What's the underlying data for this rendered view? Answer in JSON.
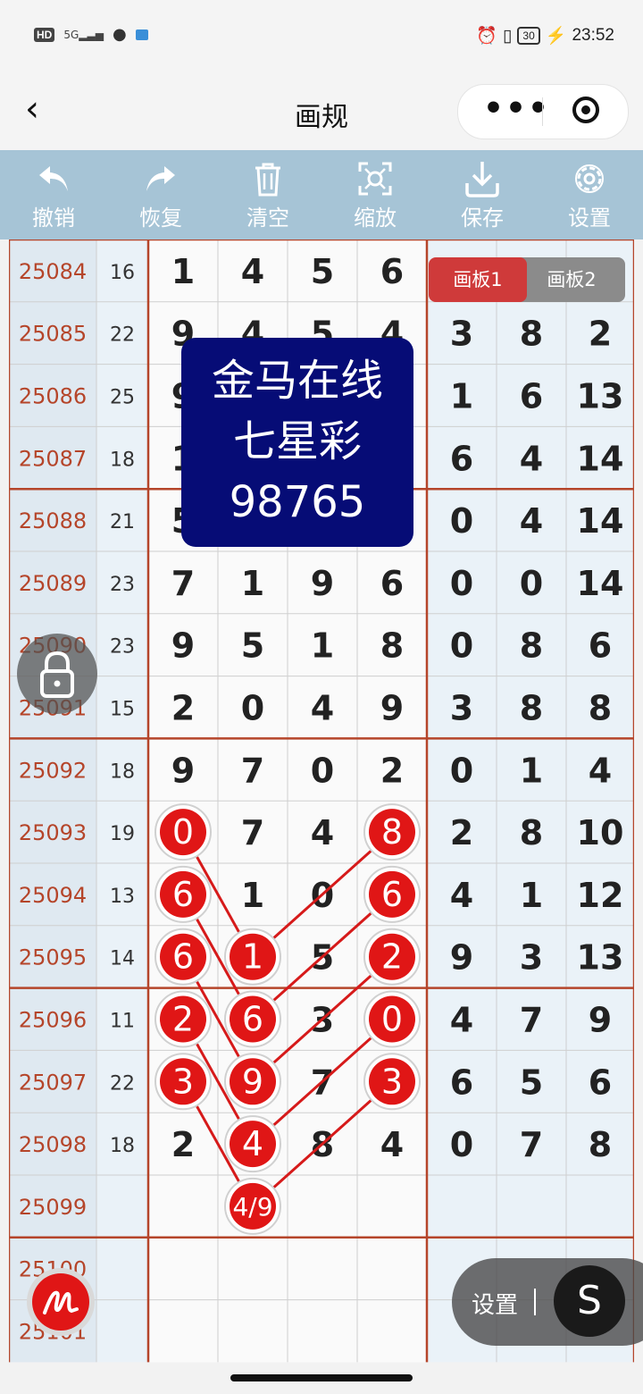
{
  "status_bar": {
    "hd": "HD",
    "signal": "5G",
    "battery": "30",
    "time": "23:52"
  },
  "nav": {
    "title": "画规"
  },
  "toolbar": [
    {
      "label": "撤销",
      "icon": "undo-icon"
    },
    {
      "label": "恢复",
      "icon": "redo-icon"
    },
    {
      "label": "清空",
      "icon": "trash-icon"
    },
    {
      "label": "缩放",
      "icon": "zoom-icon"
    },
    {
      "label": "保存",
      "icon": "save-icon"
    },
    {
      "label": "设置",
      "icon": "gear-icon"
    }
  ],
  "board_tabs": {
    "tab1": "画板1",
    "tab2": "画板2"
  },
  "watermark": {
    "line1": "金马在线",
    "line2": "七星彩",
    "line3": "98765"
  },
  "colors": {
    "accent_red": "#e01616",
    "toolbar": "#a6c4d6",
    "period_text": "#b5452a",
    "watermark_bg": "#060c76"
  },
  "table": {
    "rows": [
      {
        "period": "25084",
        "sum": "16",
        "front": [
          "1",
          "4",
          "5",
          "6"
        ],
        "back": [
          "",
          "",
          ""
        ]
      },
      {
        "period": "25085",
        "sum": "22",
        "front": [
          "9",
          "4",
          "5",
          "4"
        ],
        "back": [
          "3",
          "8",
          "2"
        ]
      },
      {
        "period": "25086",
        "sum": "25",
        "front": [
          "9",
          "",
          "",
          ""
        ],
        "back": [
          "1",
          "6",
          "13"
        ]
      },
      {
        "period": "25087",
        "sum": "18",
        "front": [
          "1",
          "",
          "",
          ""
        ],
        "back": [
          "6",
          "4",
          "14"
        ]
      },
      {
        "period": "25088",
        "sum": "21",
        "front": [
          "5",
          "",
          "",
          ""
        ],
        "back": [
          "0",
          "4",
          "14"
        ]
      },
      {
        "period": "25089",
        "sum": "23",
        "front": [
          "7",
          "1",
          "9",
          "6"
        ],
        "back": [
          "0",
          "0",
          "14"
        ]
      },
      {
        "period": "25090",
        "sum": "23",
        "front": [
          "9",
          "5",
          "1",
          "8"
        ],
        "back": [
          "0",
          "8",
          "6"
        ]
      },
      {
        "period": "25091",
        "sum": "15",
        "front": [
          "2",
          "0",
          "4",
          "9"
        ],
        "back": [
          "3",
          "8",
          "8"
        ]
      },
      {
        "period": "25092",
        "sum": "18",
        "front": [
          "9",
          "7",
          "0",
          "2"
        ],
        "back": [
          "0",
          "1",
          "4"
        ]
      },
      {
        "period": "25093",
        "sum": "19",
        "front": [
          "0",
          "7",
          "4",
          "8"
        ],
        "back": [
          "2",
          "8",
          "10"
        ]
      },
      {
        "period": "25094",
        "sum": "13",
        "front": [
          "6",
          "1",
          "0",
          "6"
        ],
        "back": [
          "4",
          "1",
          "12"
        ]
      },
      {
        "period": "25095",
        "sum": "14",
        "front": [
          "6",
          "1",
          "5",
          "2"
        ],
        "back": [
          "9",
          "3",
          "13"
        ]
      },
      {
        "period": "25096",
        "sum": "11",
        "front": [
          "2",
          "6",
          "3",
          "0"
        ],
        "back": [
          "4",
          "7",
          "9"
        ]
      },
      {
        "period": "25097",
        "sum": "22",
        "front": [
          "3",
          "9",
          "7",
          "3"
        ],
        "back": [
          "6",
          "5",
          "6"
        ]
      },
      {
        "period": "25098",
        "sum": "18",
        "front": [
          "2",
          "4",
          "8",
          "4"
        ],
        "back": [
          "0",
          "7",
          "8"
        ]
      },
      {
        "period": "25099",
        "sum": "",
        "front": [
          "",
          "4/9",
          "",
          ""
        ],
        "back": [
          "",
          "",
          ""
        ]
      },
      {
        "period": "25100",
        "sum": "",
        "front": [
          "",
          "",
          "",
          ""
        ],
        "back": [
          "",
          "",
          ""
        ]
      },
      {
        "period": "25101",
        "sum": "",
        "front": [
          "",
          "",
          "",
          ""
        ],
        "back": [
          "",
          "",
          ""
        ]
      }
    ],
    "marks": [
      {
        "row": 9,
        "col": 0,
        "text": "0"
      },
      {
        "row": 10,
        "col": 0,
        "text": "6"
      },
      {
        "row": 11,
        "col": 0,
        "text": "6"
      },
      {
        "row": 12,
        "col": 0,
        "text": "2"
      },
      {
        "row": 13,
        "col": 0,
        "text": "3"
      },
      {
        "row": 9,
        "col": 3,
        "text": "8"
      },
      {
        "row": 10,
        "col": 3,
        "text": "6"
      },
      {
        "row": 11,
        "col": 3,
        "text": "2"
      },
      {
        "row": 12,
        "col": 3,
        "text": "0"
      },
      {
        "row": 13,
        "col": 3,
        "text": "3"
      },
      {
        "row": 11,
        "col": 1,
        "text": "1"
      },
      {
        "row": 12,
        "col": 1,
        "text": "6"
      },
      {
        "row": 13,
        "col": 1,
        "text": "9"
      },
      {
        "row": 14,
        "col": 1,
        "text": "4"
      },
      {
        "row": 15,
        "col": 1,
        "text": "4/9"
      }
    ],
    "lines": [
      [
        [
          9,
          0
        ],
        [
          11,
          1
        ]
      ],
      [
        [
          10,
          0
        ],
        [
          12,
          1
        ]
      ],
      [
        [
          11,
          0
        ],
        [
          13,
          1
        ]
      ],
      [
        [
          12,
          0
        ],
        [
          14,
          1
        ]
      ],
      [
        [
          13,
          0
        ],
        [
          15,
          1
        ]
      ],
      [
        [
          9,
          3
        ],
        [
          11,
          1
        ]
      ],
      [
        [
          10,
          3
        ],
        [
          12,
          1
        ]
      ],
      [
        [
          11,
          3
        ],
        [
          13,
          1
        ]
      ],
      [
        [
          12,
          3
        ],
        [
          14,
          1
        ]
      ],
      [
        [
          13,
          3
        ],
        [
          15,
          1
        ]
      ]
    ]
  },
  "floating": {
    "settings_label": "设置",
    "s_button": "S"
  }
}
